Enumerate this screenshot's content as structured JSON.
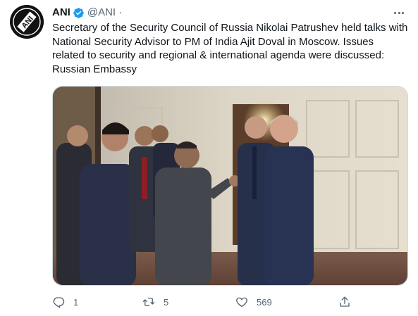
{
  "tweet": {
    "author_name": "ANI",
    "author_handle": "@ANI",
    "separator": "·",
    "verified": true,
    "text": "Secretary of the Security Council of Russia Nikolai Patrushev held talks with National Security Advisor to PM of India Ajit Doval in Moscow. Issues related to security and regional & international agenda were discussed: Russian Embassy",
    "avatar_logo_text": "ANI"
  },
  "actions": {
    "reply_count": "1",
    "retweet_count": "5",
    "like_count": "569"
  },
  "colors": {
    "text_primary": "#0f1419",
    "text_secondary": "#536471",
    "verified_blue": "#1d9bf0",
    "border": "#cfd9de"
  },
  "icons": {
    "avatar": "ani-logo-icon",
    "verified": "verified-badge-icon",
    "more": "more-icon",
    "reply": "reply-icon",
    "retweet": "retweet-icon",
    "like": "like-icon",
    "share": "share-icon"
  }
}
